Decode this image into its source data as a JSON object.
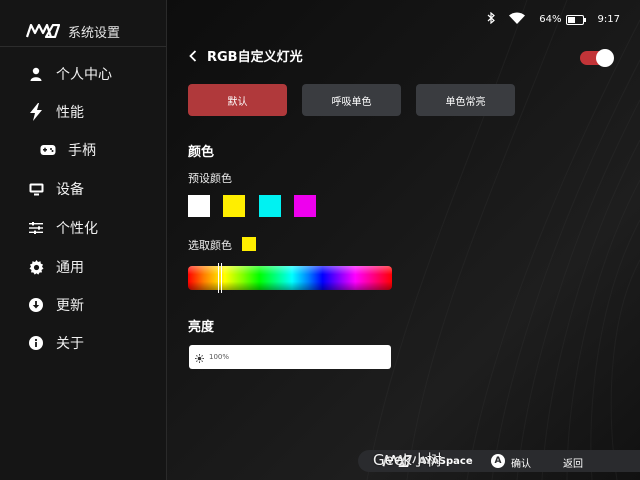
{
  "app": {
    "title": "系统设置",
    "logo": "ayaneo-logo"
  },
  "status_bar": {
    "bluetooth_icon": "bluetooth-icon",
    "wifi_icon": "wifi-icon",
    "battery": "64%",
    "battery_level": 0.64,
    "time": "9:17"
  },
  "sidebar": {
    "items": [
      {
        "label": "个人中心",
        "icon": "user-icon"
      },
      {
        "label": "性能",
        "icon": "lightning-icon"
      },
      {
        "label": "手柄",
        "icon": "gamepad-icon"
      },
      {
        "label": "设备",
        "icon": "display-icon"
      },
      {
        "label": "个性化",
        "icon": "sliders-icon"
      },
      {
        "label": "通用",
        "icon": "gear-icon"
      },
      {
        "label": "更新",
        "icon": "download-icon"
      },
      {
        "label": "关于",
        "icon": "info-icon"
      }
    ]
  },
  "page": {
    "title": "RGB自定义灯光",
    "toggle_on": true
  },
  "modes": [
    {
      "label": "默认",
      "active": true
    },
    {
      "label": "呼吸单色",
      "active": false
    },
    {
      "label": "单色常亮",
      "active": false
    }
  ],
  "color_section": {
    "title": "颜色",
    "preset_label": "预设颜色",
    "presets": [
      "#ffffff",
      "#ffee00",
      "#00f2f2",
      "#ee00ee"
    ],
    "picked_label": "选取颜色",
    "picked_color": "#ffee00"
  },
  "brightness": {
    "title": "亮度",
    "value": "100%"
  },
  "bottom_bar": {
    "brand": "AYASpace",
    "a_key": "A",
    "a_label": "确认",
    "b_label": "返回"
  },
  "watermark": "Geek小树",
  "colors": {
    "accent": "#b0393b",
    "toggle": "#c23438",
    "button": "#3a3c40"
  }
}
